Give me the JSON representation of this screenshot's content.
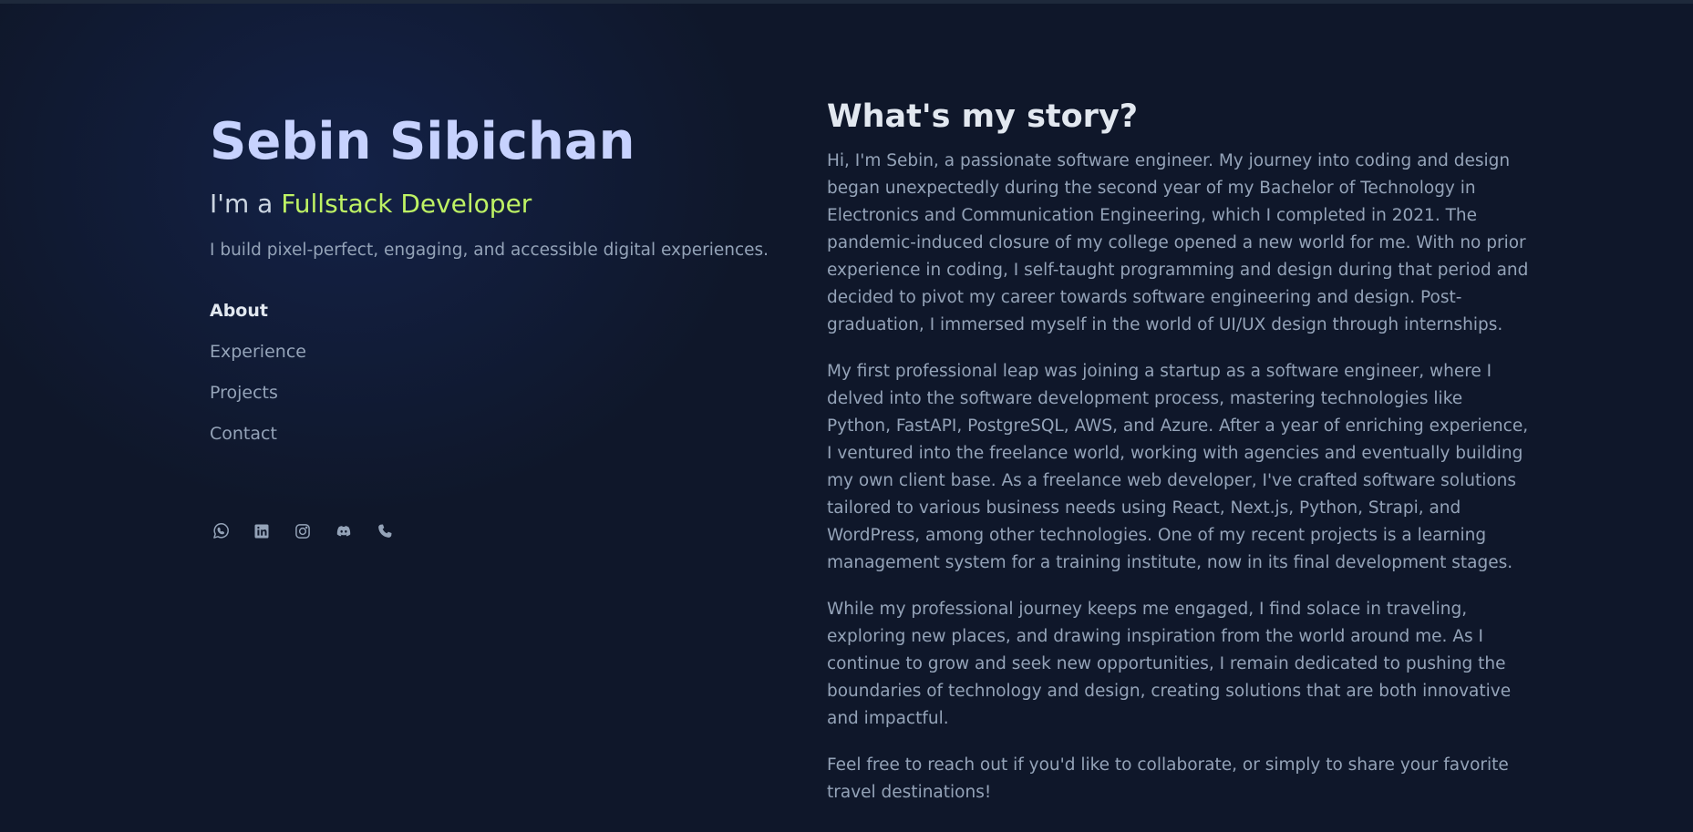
{
  "profile": {
    "name": "Sebin Sibichan",
    "role_prefix": "I'm a ",
    "role_highlight": "Fullstack Developer",
    "tagline": "I build pixel-perfect, engaging, and accessible digital experiences."
  },
  "nav": {
    "items": [
      {
        "label": "About",
        "active": true
      },
      {
        "label": "Experience",
        "active": false
      },
      {
        "label": "Projects",
        "active": false
      },
      {
        "label": "Contact",
        "active": false
      }
    ]
  },
  "socials": [
    {
      "icon": "whatsapp-icon"
    },
    {
      "icon": "linkedin-icon"
    },
    {
      "icon": "instagram-icon"
    },
    {
      "icon": "discord-icon"
    },
    {
      "icon": "phone-icon"
    }
  ],
  "story": {
    "title": "What's my story?",
    "paragraphs": [
      "Hi, I'm Sebin, a passionate software engineer. My journey into coding and design began unexpectedly during the second year of my Bachelor of Technology in Electronics and Communication Engineering, which I completed in 2021. The pandemic-induced closure of my college opened a new world for me. With no prior experience in coding, I self-taught programming and design during that period and decided to pivot my career towards software engineering and design. Post-graduation, I immersed myself in the world of UI/UX design through internships.",
      "My first professional leap was joining a startup as a software engineer, where I delved into the software development process, mastering technologies like Python, FastAPI, PostgreSQL, AWS, and Azure. After a year of enriching experience, I ventured into the freelance world, working with agencies and eventually building my own client base. As a freelance web developer, I've crafted software solutions tailored to various business needs using React, Next.js, Python, Strapi, and WordPress, among other technologies. One of my recent projects is a learning management system for a training institute, now in its final development stages.",
      "While my professional journey keeps me engaged, I find solace in traveling, exploring new places, and drawing inspiration from the world around me. As I continue to grow and seek new opportunities, I remain dedicated to pushing the boundaries of technology and design, creating solutions that are both innovative and impactful.",
      "Feel free to reach out if you'd like to collaborate, or simply to share your favorite travel destinations!"
    ]
  },
  "colors": {
    "background": "#0f172a",
    "name": "#c7d2fe",
    "accent": "#bef264",
    "text_muted": "#94a3b8",
    "text_bright": "#e2e8f0",
    "icon": "#94a3b8"
  }
}
